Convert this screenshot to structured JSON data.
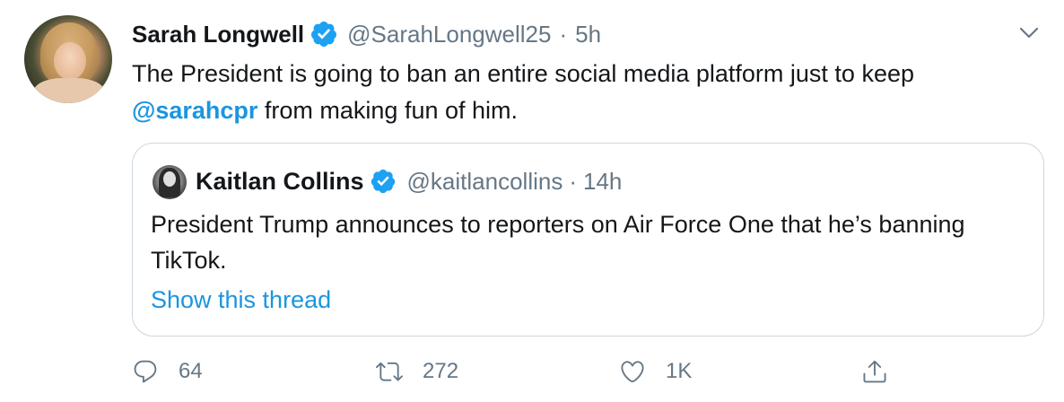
{
  "tweet": {
    "author": {
      "name": "Sarah Longwell",
      "handle": "@SarahLongwell25",
      "time": "5h"
    },
    "text_before": "The President is going to ban an entire social media platform just to keep ",
    "mention": "@sarahcpr",
    "text_after": " from making fun of him.",
    "separator": "·",
    "quoted": {
      "name": "Kaitlan Collins",
      "handle": "@kaitlancollins",
      "time": "14h",
      "text": "President Trump announces to reporters on Air Force One that he’s banning TikTok.",
      "show_thread": "Show this thread"
    },
    "actions": {
      "replies": "64",
      "retweets": "272",
      "likes": "1K"
    }
  },
  "colors": {
    "accent": "#1b95e0",
    "verified": "#1da1f2",
    "secondary_text": "#657786",
    "primary_text": "#14171a",
    "border": "#ccd6dd"
  },
  "icons": {
    "verified": "verified-badge-icon",
    "more": "chevron-down-icon",
    "reply": "reply-icon",
    "retweet": "retweet-icon",
    "like": "heart-icon",
    "share": "share-icon"
  }
}
